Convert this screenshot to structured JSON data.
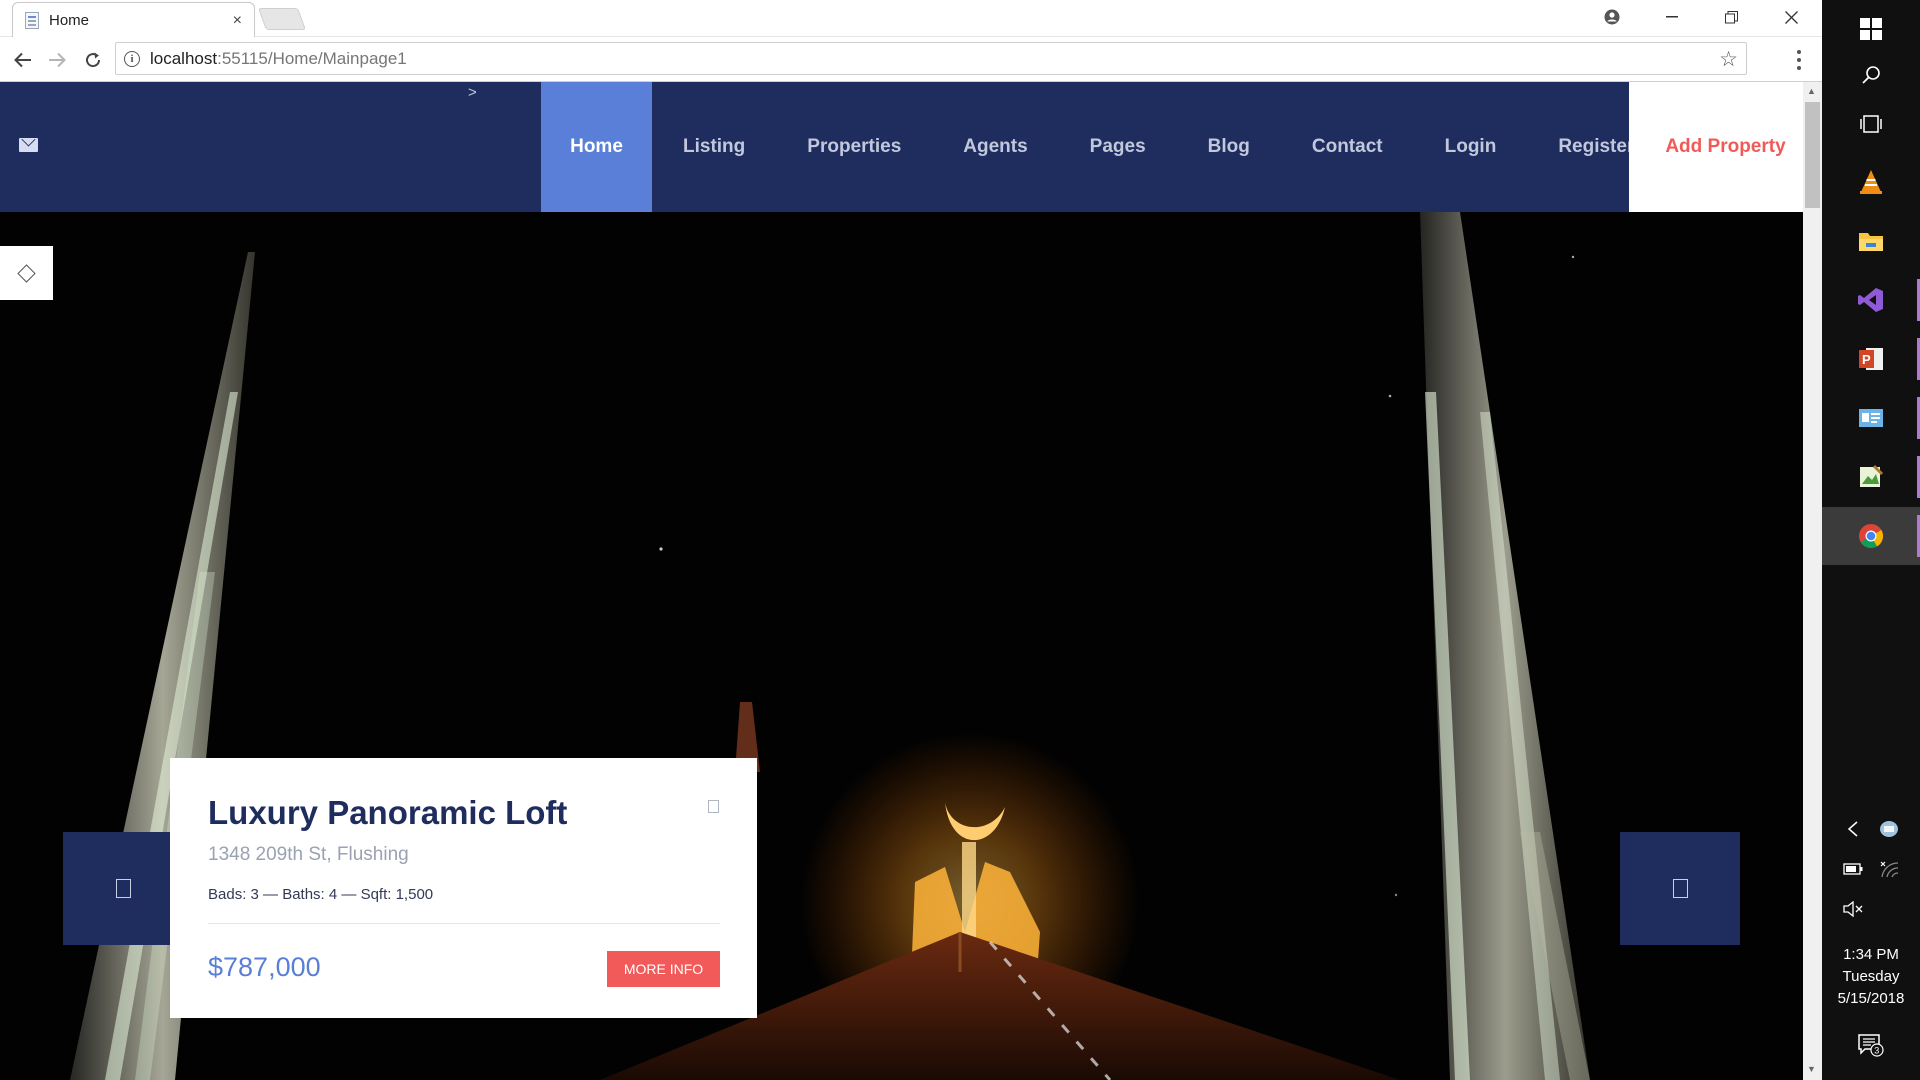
{
  "browser": {
    "tab_title": "Home",
    "tab_close": "×",
    "url_host": "localhost",
    "url_path": ":55115/Home/Mainpage1",
    "window_controls": [
      "minimize-icon",
      "restore-icon",
      "close-icon"
    ]
  },
  "header": {
    "chevron": ">",
    "nav": [
      {
        "label": "Home",
        "active": true
      },
      {
        "label": "Listing"
      },
      {
        "label": "Properties"
      },
      {
        "label": "Agents"
      },
      {
        "label": "Pages"
      },
      {
        "label": "Blog"
      },
      {
        "label": "Contact"
      },
      {
        "label": "Login"
      },
      {
        "label": "Register"
      }
    ],
    "cta": "Add Property"
  },
  "listing": {
    "title": "Luxury Panoramic Loft",
    "address": "1348 209th St, Flushing",
    "specs": "Bads: 3 — Baths: 4 — Sqft: 1,500",
    "price": "$787,000",
    "button": "MORE INFO"
  },
  "taskbar": {
    "time": "1:34 PM",
    "day": "Tuesday",
    "date": "5/15/2018",
    "notifications": "3"
  },
  "colors": {
    "navy": "#1e2d5e",
    "accent_blue": "#5a7fd8",
    "accent_red": "#f25a5a"
  }
}
